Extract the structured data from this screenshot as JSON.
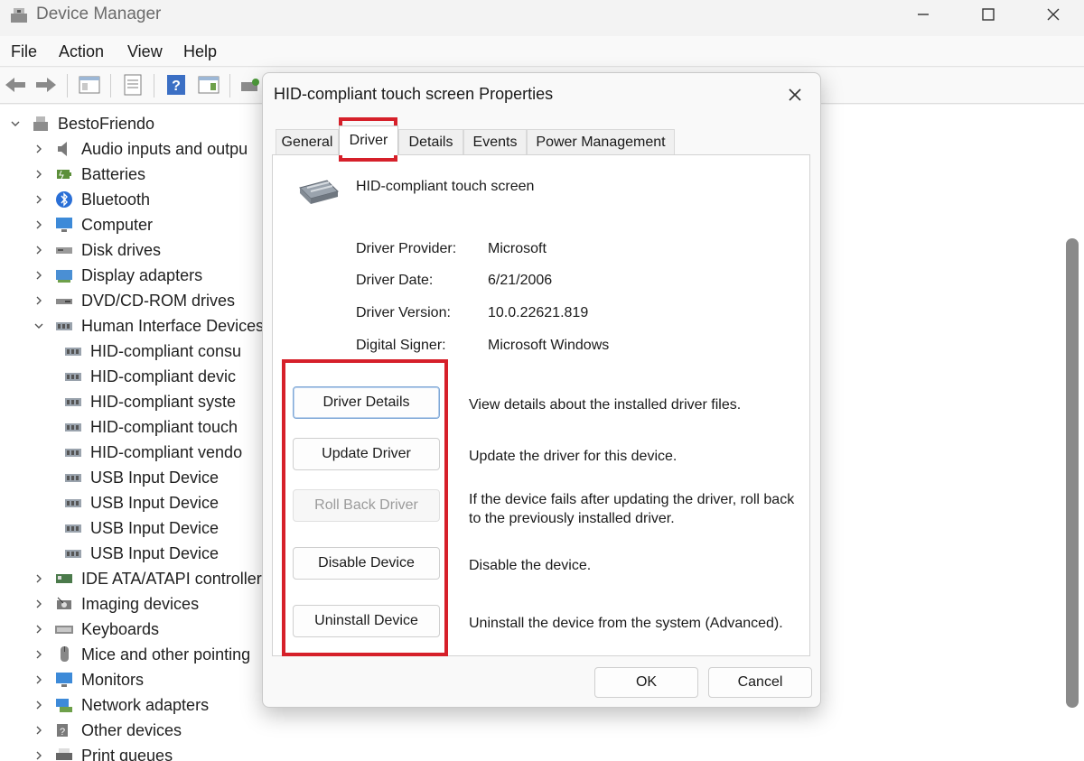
{
  "window": {
    "title": "Device Manager",
    "menu": [
      "File",
      "Action",
      "View",
      "Help"
    ]
  },
  "tree": {
    "root": "BestoFriendo",
    "items": [
      {
        "label": "Audio inputs and outpu",
        "icon": "speaker-icon"
      },
      {
        "label": "Batteries",
        "icon": "battery-icon"
      },
      {
        "label": "Bluetooth",
        "icon": "bluetooth-icon"
      },
      {
        "label": "Computer",
        "icon": "monitor-icon"
      },
      {
        "label": "Disk drives",
        "icon": "disk-icon"
      },
      {
        "label": "Display adapters",
        "icon": "display-adapter-icon"
      },
      {
        "label": "DVD/CD-ROM drives",
        "icon": "dvd-icon"
      },
      {
        "label": "Human Interface Devices",
        "icon": "hid-icon"
      },
      {
        "label": "HID-compliant consu",
        "icon": "hid-icon"
      },
      {
        "label": "HID-compliant devic",
        "icon": "hid-icon"
      },
      {
        "label": "HID-compliant syste",
        "icon": "hid-icon"
      },
      {
        "label": "HID-compliant touch",
        "icon": "hid-icon"
      },
      {
        "label": "HID-compliant vendo",
        "icon": "hid-icon"
      },
      {
        "label": "USB Input Device",
        "icon": "hid-icon"
      },
      {
        "label": "USB Input Device",
        "icon": "hid-icon"
      },
      {
        "label": "USB Input Device",
        "icon": "hid-icon"
      },
      {
        "label": "USB Input Device",
        "icon": "hid-icon"
      },
      {
        "label": "IDE ATA/ATAPI controllers",
        "icon": "ide-icon"
      },
      {
        "label": "Imaging devices",
        "icon": "camera-icon"
      },
      {
        "label": "Keyboards",
        "icon": "keyboard-icon"
      },
      {
        "label": "Mice and other pointing",
        "icon": "mouse-icon"
      },
      {
        "label": "Monitors",
        "icon": "monitor-icon"
      },
      {
        "label": "Network adapters",
        "icon": "network-icon"
      },
      {
        "label": "Other devices",
        "icon": "unknown-device-icon"
      },
      {
        "label": "Print queues",
        "icon": "printer-icon"
      }
    ]
  },
  "dialog": {
    "title": "HID-compliant touch screen Properties",
    "tabs": [
      "General",
      "Driver",
      "Details",
      "Events",
      "Power Management"
    ],
    "active_tab": "Driver",
    "device_name": "HID-compliant touch screen",
    "info": [
      {
        "label": "Driver Provider:",
        "value": "Microsoft"
      },
      {
        "label": "Driver Date:",
        "value": "6/21/2006"
      },
      {
        "label": "Driver Version:",
        "value": "10.0.22621.819"
      },
      {
        "label": "Digital Signer:",
        "value": "Microsoft Windows"
      }
    ],
    "actions": [
      {
        "label": "Driver Details",
        "desc": "View details about the installed driver files."
      },
      {
        "label": "Update Driver",
        "desc": "Update the driver for this device."
      },
      {
        "label": "Roll Back Driver",
        "desc": "If the device fails after updating the driver, roll back to the previously installed driver."
      },
      {
        "label": "Disable Device",
        "desc": "Disable the device."
      },
      {
        "label": "Uninstall Device",
        "desc": "Uninstall the device from the system (Advanced)."
      }
    ],
    "ok_label": "OK",
    "cancel_label": "Cancel"
  },
  "colors": {
    "highlight": "#d6202a",
    "focus_border": "#7ea7d6",
    "disabled_text": "#9b9b9b"
  }
}
